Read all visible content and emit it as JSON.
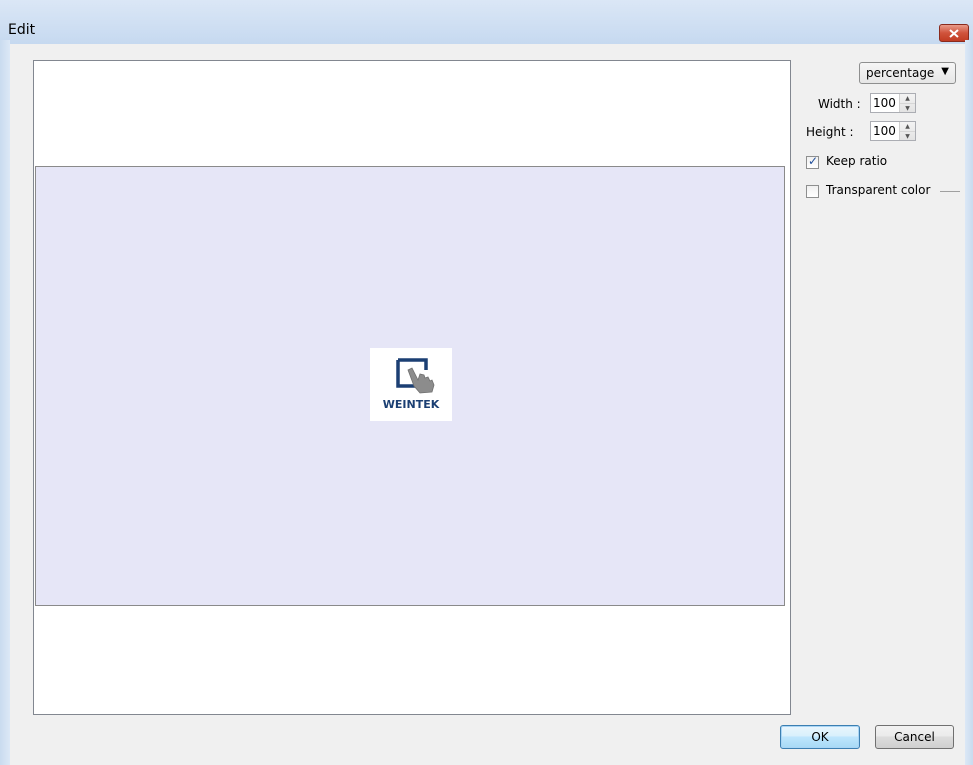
{
  "window": {
    "title": "Edit",
    "close_label": "x"
  },
  "preview": {
    "logo_text": "WEINTEK"
  },
  "side_panel": {
    "unit_select": {
      "value": "percentage",
      "arrow": "▼"
    },
    "width": {
      "label": "Width :",
      "value": "100"
    },
    "height": {
      "label": "Height :",
      "value": "100"
    },
    "keep_ratio": {
      "label": "Keep ratio",
      "checked": true
    },
    "transparent_color": {
      "label": "Transparent color",
      "checked": false
    }
  },
  "buttons": {
    "ok": "OK",
    "cancel": "Cancel"
  },
  "colors": {
    "image_bg": "#e6e6f7",
    "logo_blue": "#1b3f73",
    "title_bar": "#c6d9f0"
  }
}
